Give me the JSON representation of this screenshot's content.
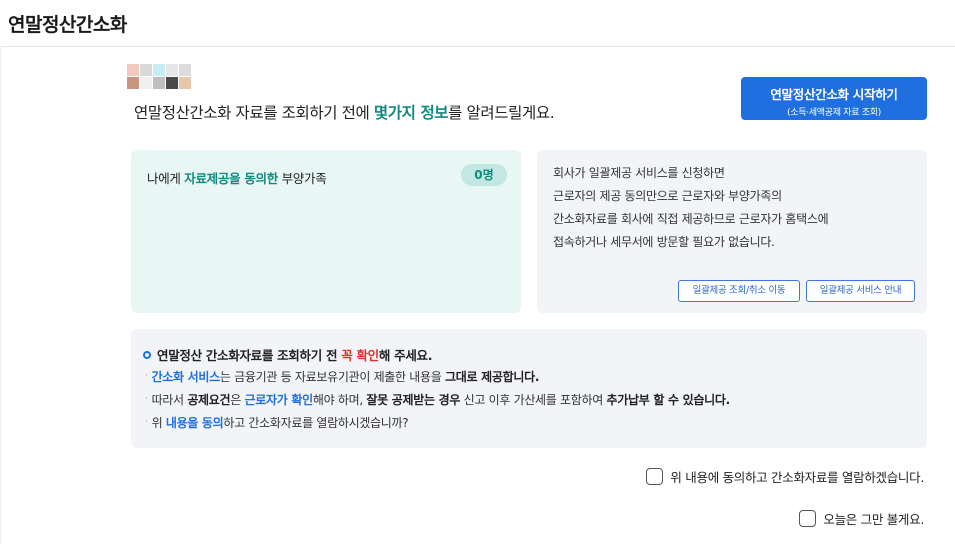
{
  "header": {
    "title": "연말정산간소화"
  },
  "intro": {
    "before": "연말정산간소화 자료를 조회하기 전에 ",
    "highlight": "몇가지 정보",
    "after": "를 알려드릴게요."
  },
  "start_button": {
    "label": "연말정산간소화 시작하기",
    "sublabel": "(소득·세액공제 자료 조회)"
  },
  "consent_panel": {
    "label_prefix": "나에게 ",
    "label_highlight": "자료제공을 동의한",
    "label_suffix": " 부양가족",
    "count": "0명"
  },
  "info_panel": {
    "lines": [
      "회사가 일괄제공 서비스를 신청하면",
      "근로자의 제공 동의만으로 근로자와 부양가족의",
      "간소화자료를 회사에 직접 제공하므로 근로자가 홈택스에",
      "접속하거나 세무서에 방문할 필요가 없습니다."
    ],
    "buttons": {
      "inquiry": "일괄제공 조회/취소 이동",
      "guide": "일괄제공 서비스 안내"
    }
  },
  "notice": {
    "heading_before": "연말정산 간소화자료를 조회하기 전 ",
    "heading_red": "꼭 확인",
    "heading_after": "해 주세요.",
    "line1": {
      "blue": "간소화 서비스",
      "mid": "는 금융기관 등 자료보유기관이 제출한 내용을 ",
      "bold": "그대로 제공합니다."
    },
    "line2": {
      "pre": "따라서 ",
      "bold1": "공제요건",
      "mid1": "은 ",
      "blue": "근로자가 확인",
      "mid2": "해야 하며, ",
      "bold2": "잘못 공제받는 경우",
      "mid3": " 신고 이후 가산세를 포함하여 ",
      "bold3": "추가납부 할 수 있습니다."
    },
    "line3": {
      "pre": "위 ",
      "blue": "내용을 동의",
      "post": "하고 간소화자료를 열람하시겠습니까?"
    }
  },
  "checkboxes": {
    "agree": {
      "label": "위 내용에 동의하고 간소화자료를 열람하겠습니다.",
      "checked": false
    },
    "hide_today": {
      "label": "오늘은 그만 볼게요.",
      "checked": false
    }
  },
  "colors": {
    "accent_blue": "#1f6fe0",
    "accent_teal": "#118a80",
    "warning_red": "#e0312b",
    "consent_bg": "#e8f7f4",
    "panel_bg": "#f2f4f8"
  }
}
